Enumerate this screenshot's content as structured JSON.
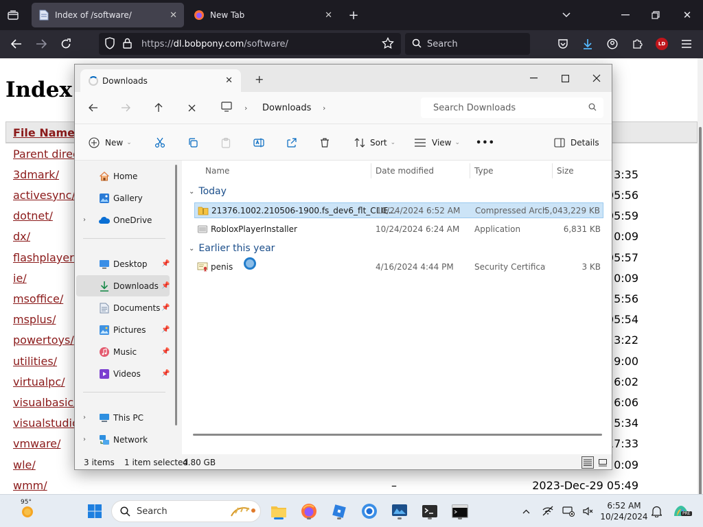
{
  "browser": {
    "tabs": [
      {
        "title": "Index of /software/"
      },
      {
        "title": "New Tab"
      }
    ],
    "url_scheme": "https://",
    "url_domain": "dl.bobpony.com",
    "url_path": "/software/",
    "search_placeholder": "Search",
    "extension_badge": "LD"
  },
  "page": {
    "heading": "Index",
    "column_file_name": "File Name",
    "entries": [
      {
        "name": "Parent direc",
        "date": ""
      },
      {
        "name": "3dmark/",
        "date": "3:35"
      },
      {
        "name": "activesync/",
        "date": "05:56"
      },
      {
        "name": "dotnet/",
        "date": "05:59"
      },
      {
        "name": "dx/",
        "date": "0:09"
      },
      {
        "name": "flashplayer/",
        "date": "05:57"
      },
      {
        "name": "ie/",
        "date": "0:09"
      },
      {
        "name": "msoffice/",
        "date": "5:56"
      },
      {
        "name": "msplus/",
        "date": "05:54"
      },
      {
        "name": "powertoys/",
        "date": "3:22"
      },
      {
        "name": "utilities/",
        "date": "9:00"
      },
      {
        "name": "virtualpc/",
        "date": "6:02"
      },
      {
        "name": "visualbasic/",
        "date": "6:06"
      },
      {
        "name": "visualstudio",
        "date": "5:34"
      },
      {
        "name": "vmware/",
        "date": "17:33"
      },
      {
        "name": "wle/",
        "date": "0:09"
      },
      {
        "name": "wmm/",
        "date": "2023-Dec-29 05:49"
      }
    ],
    "dash": "–"
  },
  "explorer": {
    "tab_title": "Downloads",
    "breadcrumb_location": "Downloads",
    "search_placeholder": "Search Downloads",
    "toolbar": {
      "new_label": "New",
      "sort_label": "Sort",
      "view_label": "View",
      "more_label": "•••",
      "details_label": "Details"
    },
    "nav": {
      "home": "Home",
      "gallery": "Gallery",
      "onedrive": "OneDrive",
      "desktop": "Desktop",
      "downloads": "Downloads",
      "documents": "Documents",
      "pictures": "Pictures",
      "music": "Music",
      "videos": "Videos",
      "this_pc": "This PC",
      "network": "Network"
    },
    "columns": {
      "name": "Name",
      "date": "Date modified",
      "type": "Type",
      "size": "Size"
    },
    "groups": {
      "today": "Today",
      "earlier": "Earlier this year"
    },
    "files": [
      {
        "name": "21376.1002.210506-1900.fs_dev6_flt_CLIE...",
        "date": "10/24/2024 6:52 AM",
        "type": "Compressed Archi...",
        "size": "5,043,229 KB"
      },
      {
        "name": "RobloxPlayerInstaller",
        "date": "10/24/2024 6:24 AM",
        "type": "Application",
        "size": "6,831 KB"
      },
      {
        "name": "penis",
        "date": "4/16/2024 4:44 PM",
        "type": "Security Certificate",
        "size": "3 KB"
      }
    ],
    "status": {
      "items": "3 items",
      "selected": "1 item selected",
      "selected_size": "4.80 GB"
    }
  },
  "taskbar": {
    "weather_temp": "95°",
    "search_label": "Search",
    "time": "6:52 AM",
    "date": "10/24/2024",
    "copilot_badge": "PRE"
  },
  "colors": {
    "link": "#8b1a1a",
    "selection": "#cce4f7",
    "accent": "#0067c0"
  }
}
